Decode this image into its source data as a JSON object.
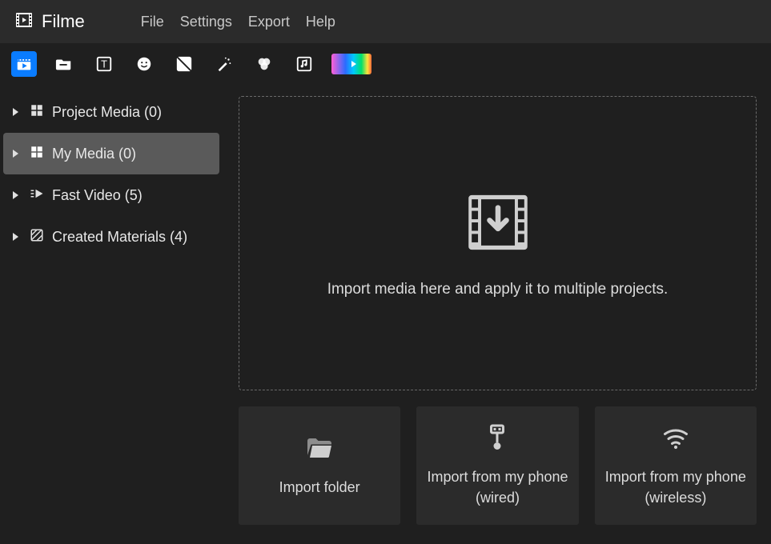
{
  "app": {
    "name": "Filme"
  },
  "menu": {
    "file": "File",
    "settings": "Settings",
    "export": "Export",
    "help": "Help"
  },
  "toolbar": {
    "icons": [
      "media",
      "folder",
      "text",
      "sticker",
      "transition",
      "magic",
      "color",
      "music",
      "gradient"
    ]
  },
  "sidebar": {
    "project_media": {
      "label": "Project Media (0)"
    },
    "my_media": {
      "label": "My Media (0)"
    },
    "fast_video": {
      "label": "Fast Video (5)"
    },
    "created_materials": {
      "label": "Created Materials (4)"
    }
  },
  "dropzone": {
    "hint": "Import media here and apply it to multiple projects."
  },
  "cards": {
    "import_folder": "Import folder",
    "import_phone_wired": "Import from my phone (wired)",
    "import_phone_wireless": "Import from my phone (wireless)"
  }
}
